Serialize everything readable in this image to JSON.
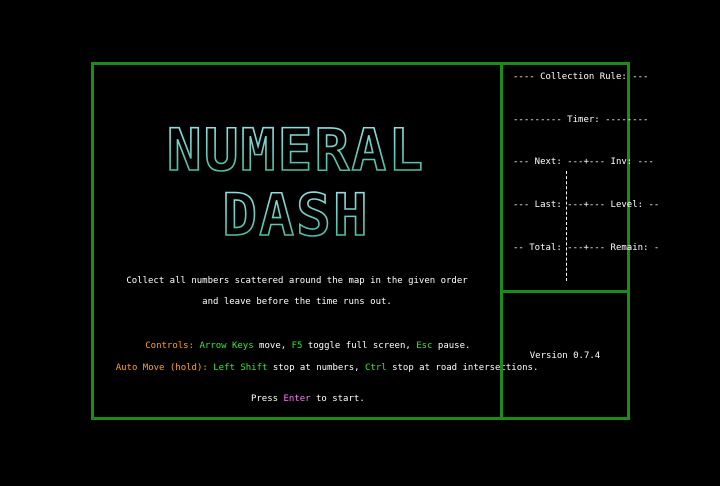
{
  "title": {
    "line1": "NUMERAL",
    "line2": "DASH"
  },
  "intro": {
    "line1": "Collect all numbers scattered around the map in the given order",
    "line2": "and leave before the time runs out."
  },
  "controls": {
    "label": "Controls:",
    "keys1": "Arrow Keys",
    "t1": " move, ",
    "keys2": "F5",
    "t2": " toggle full screen, ",
    "keys3": "Esc",
    "t3": " pause."
  },
  "automove": {
    "label": "Auto Move (hold):",
    "keys1": " Left Shift",
    "t1": " stop at numbers, ",
    "keys2": "Ctrl",
    "t2": " stop at road intersections."
  },
  "start": {
    "pre": "Press ",
    "key": "Enter",
    "post": " to start."
  },
  "sidebar": {
    "collection": "---- Collection Rule: ---",
    "timer": "--------- Timer: --------",
    "next_inv": "--- Next: ---+--- Inv: ---",
    "last_level": "--- Last: ---+--- Level: --",
    "total_remain": "-- Total: ---+--- Remain: -"
  },
  "version": "Version 0.7.4",
  "colors": {
    "border": "#1a8c1a",
    "key": "#33e633",
    "label": "#ffa500",
    "enter": "#ff77ff",
    "logo": "#4fd1c5"
  }
}
